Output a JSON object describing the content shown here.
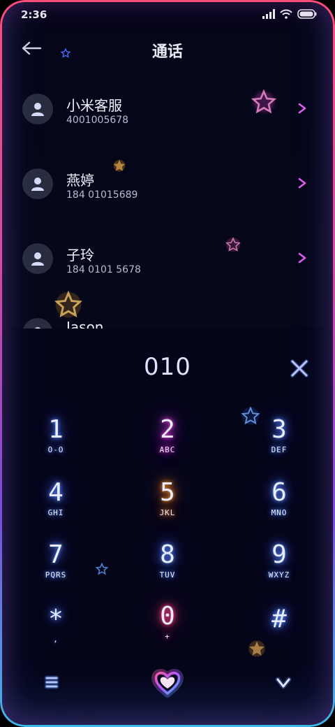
{
  "status_bar": {
    "time": "2:36",
    "icons": [
      "signal-icon",
      "wifi-icon",
      "battery-icon"
    ]
  },
  "header": {
    "title": "通话",
    "back_icon": "back-arrow-icon"
  },
  "contacts": [
    {
      "name": "小米客服",
      "number": "4001005678"
    },
    {
      "name": "燕婷",
      "number": "184 01015689"
    },
    {
      "name": "子玲",
      "number": "184 0101 5678"
    },
    {
      "name": "Jason",
      "number": ""
    }
  ],
  "dialer": {
    "number": "010",
    "keys": [
      {
        "digit": "1",
        "letters": "O-O"
      },
      {
        "digit": "2",
        "letters": "ABC"
      },
      {
        "digit": "3",
        "letters": "DEF"
      },
      {
        "digit": "4",
        "letters": "GHI"
      },
      {
        "digit": "5",
        "letters": "JKL"
      },
      {
        "digit": "6",
        "letters": "MNO"
      },
      {
        "digit": "7",
        "letters": "PQRS"
      },
      {
        "digit": "8",
        "letters": "TUV"
      },
      {
        "digit": "9",
        "letters": "WXYZ"
      },
      {
        "digit": "*",
        "letters": ","
      },
      {
        "digit": "0",
        "letters": "+"
      },
      {
        "digit": "#",
        "letters": ""
      }
    ],
    "bottom_bar": {
      "left_icon": "menu-icon",
      "center_icon": "heart-call-icon",
      "right_icon": "collapse-icon"
    }
  },
  "colors": {
    "background": "#06061a",
    "frame_top": "#ff4d7a",
    "frame_bottom": "#3fb6e6",
    "glow_blue": "#5a8bff",
    "glow_pink": "#d23cff",
    "glow_orange": "#ff9a30",
    "chevron": "#e35cf2"
  }
}
